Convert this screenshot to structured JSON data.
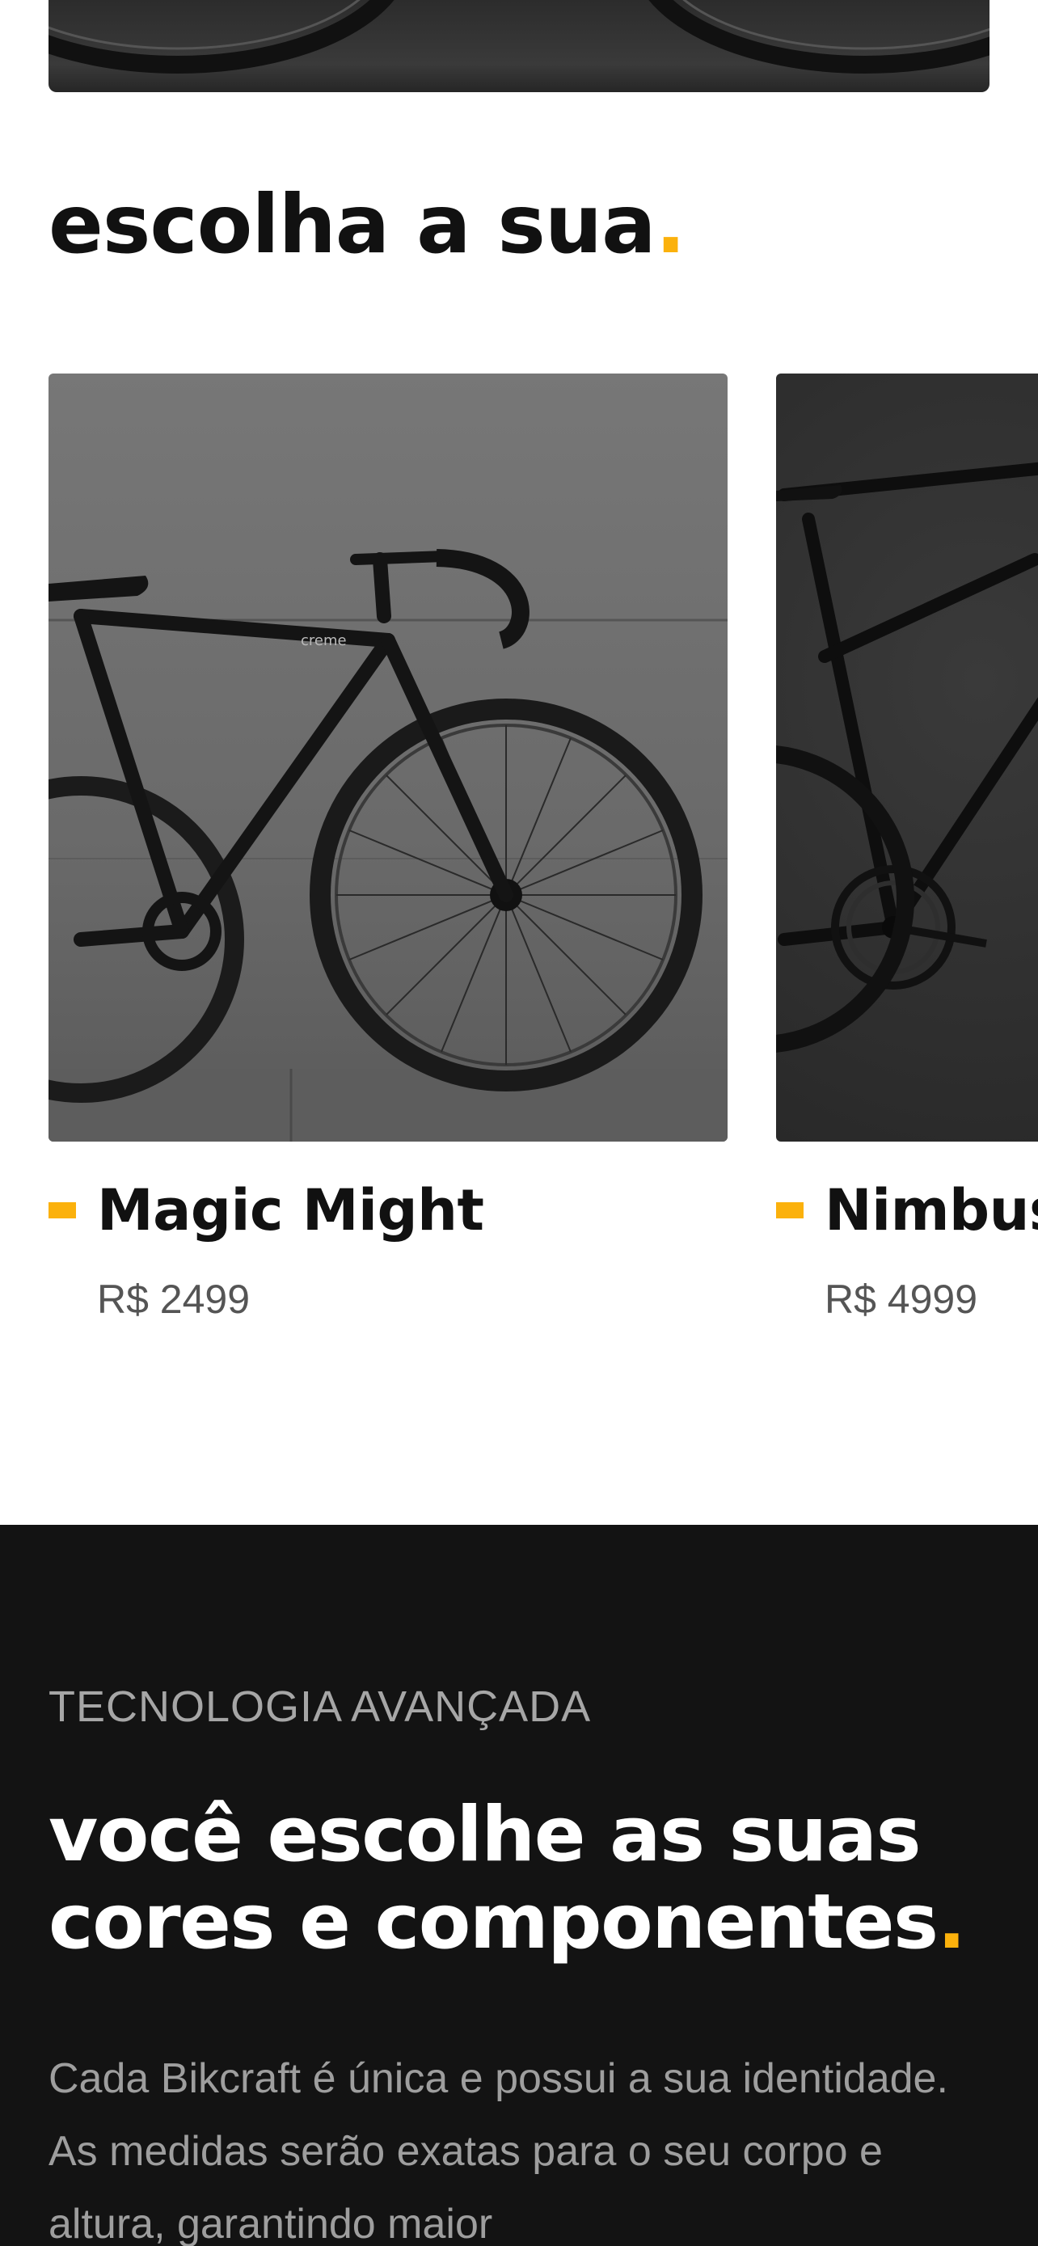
{
  "section": {
    "title": "escolha a sua",
    "title_accent": "."
  },
  "products": [
    {
      "name": "Magic Might",
      "price": "R$ 2499"
    },
    {
      "name": "Nimbus",
      "price": "R$ 4999"
    }
  ],
  "technology": {
    "eyebrow": "TECNOLOGIA AVANÇADA",
    "headline_line1": "você escolhe as suas",
    "headline_line2": "cores e componentes",
    "headline_accent": ".",
    "body": "Cada Bikcraft é única e possui a sua identidade. As medidas serão exatas para o seu corpo e altura, garantindo maior"
  },
  "colors": {
    "accent": "#fbb10c",
    "dark_section": "#131313",
    "text_dark": "#111111",
    "price_gray": "#555555"
  }
}
